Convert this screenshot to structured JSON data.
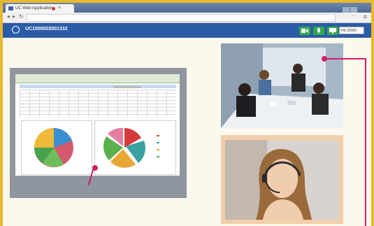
{
  "browser": {
    "tab_title": "UC Web Application"
  },
  "app": {
    "meeting_id": "UC1000002001332",
    "quality_select": "Hd (256K)"
  },
  "colors": {
    "header": "#2a5ca8",
    "control_green": "#34a84a",
    "annotation": "#cf1f67",
    "frame": "#e8b830"
  }
}
